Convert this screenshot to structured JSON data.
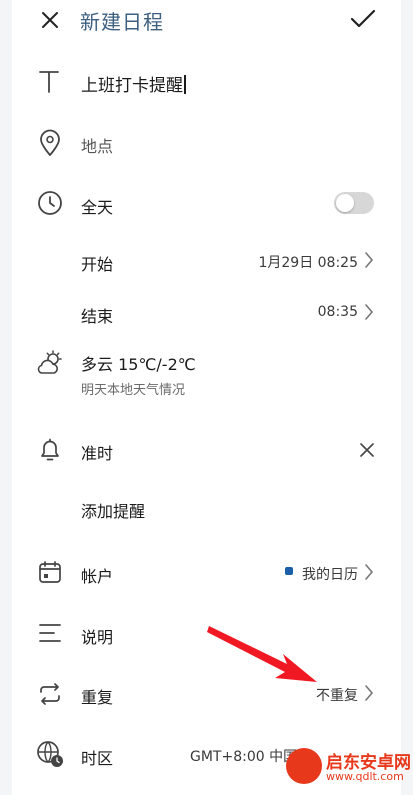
{
  "header": {
    "title": "新建日程",
    "close_icon": "close-icon",
    "confirm_icon": "check-icon"
  },
  "event": {
    "title_value": "上班打卡提醒",
    "location_placeholder": "地点"
  },
  "all_day": {
    "label": "全天",
    "enabled": false
  },
  "start": {
    "label": "开始",
    "value": "1月29日 08:25"
  },
  "end": {
    "label": "结束",
    "value": "08:35"
  },
  "weather": {
    "label": "多云 15℃/-2℃",
    "sub": "明天本地天气情况"
  },
  "reminder": {
    "label": "准时",
    "add_label": "添加提醒"
  },
  "account": {
    "label": "帐户",
    "value": "我的日历",
    "color": "#1a5fa8"
  },
  "description": {
    "label": "说明"
  },
  "repeat": {
    "label": "重复",
    "value": "不重复"
  },
  "timezone": {
    "label": "时区",
    "value": "GMT+8:00 中国"
  },
  "watermark": {
    "line1": "启东安卓网",
    "line2": "www.qdlt.com"
  },
  "colors": {
    "title": "#3d5f80",
    "annotation_arrow": "#f01822",
    "watermark": "#e8381c"
  }
}
